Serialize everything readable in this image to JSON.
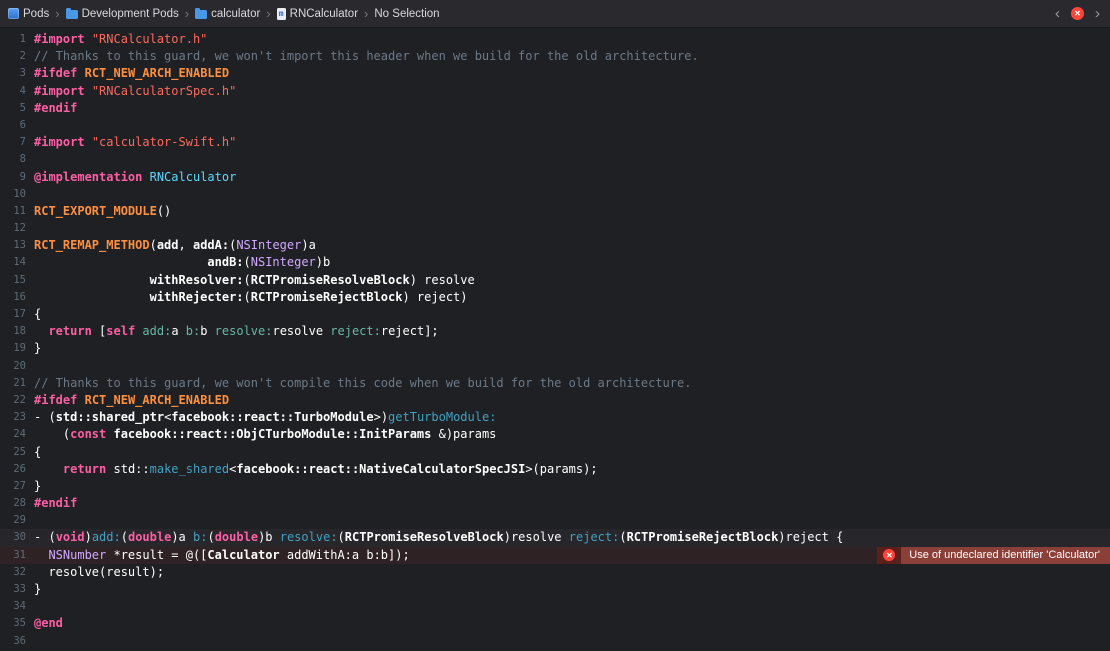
{
  "breadcrumb": {
    "items": [
      {
        "label": "Pods",
        "icon": "project"
      },
      {
        "label": "Development Pods",
        "icon": "folder"
      },
      {
        "label": "calculator",
        "icon": "folder"
      },
      {
        "label": "RNCalculator",
        "icon": "file-m"
      },
      {
        "label": "No Selection",
        "icon": "none"
      }
    ],
    "separator": "›",
    "nav": {
      "back": "‹",
      "forward": "›"
    },
    "issues": {
      "error_glyph": "✕",
      "file_icon_glyph": "m"
    }
  },
  "colors": {
    "background": "#1f2024",
    "topbar": "#29292e",
    "keyword": "#fc5fa3",
    "macro": "#fd8f3f",
    "string": "#fc6a5d",
    "comment": "#6c7986",
    "other_type": "#d0a8ff",
    "type_declaration": "#5dd8ff",
    "project_method": "#67b7a4",
    "other_declaration": "#41a1c0",
    "plain_text": "#ffffff",
    "line_number": "#5f6b76",
    "error_badge": "#ff453a",
    "error_banner": "#8a3f38"
  },
  "editor": {
    "error": {
      "line": 31,
      "message": "Use of undeclared identifier 'Calculator'",
      "icon_glyph": "✕"
    },
    "current_line": 30,
    "lines": [
      {
        "n": 1,
        "tokens": [
          {
            "c": "kw",
            "t": "#import"
          },
          {
            "c": "pln",
            "t": " "
          },
          {
            "c": "str",
            "t": "\"RNCalculator.h\""
          }
        ]
      },
      {
        "n": 2,
        "tokens": [
          {
            "c": "com",
            "t": "// Thanks to this guard, we won't import this header when we build for the old architecture."
          }
        ]
      },
      {
        "n": 3,
        "tokens": [
          {
            "c": "kw",
            "t": "#ifdef"
          },
          {
            "c": "pln",
            "t": " "
          },
          {
            "c": "mac",
            "t": "RCT_NEW_ARCH_ENABLED"
          }
        ]
      },
      {
        "n": 4,
        "tokens": [
          {
            "c": "kw",
            "t": "#import"
          },
          {
            "c": "pln",
            "t": " "
          },
          {
            "c": "str",
            "t": "\"RNCalculatorSpec.h\""
          }
        ]
      },
      {
        "n": 5,
        "tokens": [
          {
            "c": "kw",
            "t": "#endif"
          }
        ]
      },
      {
        "n": 6,
        "tokens": []
      },
      {
        "n": 7,
        "tokens": [
          {
            "c": "kw",
            "t": "#import"
          },
          {
            "c": "pln",
            "t": " "
          },
          {
            "c": "str",
            "t": "\"calculator-Swift.h\""
          }
        ]
      },
      {
        "n": 8,
        "tokens": []
      },
      {
        "n": 9,
        "tokens": [
          {
            "c": "kw",
            "t": "@implementation"
          },
          {
            "c": "pln",
            "t": " "
          },
          {
            "c": "cls",
            "t": "RNCalculator"
          }
        ]
      },
      {
        "n": 10,
        "tokens": []
      },
      {
        "n": 11,
        "tokens": [
          {
            "c": "mac",
            "t": "RCT_EXPORT_MODULE"
          },
          {
            "c": "pln",
            "t": "()"
          }
        ]
      },
      {
        "n": 12,
        "tokens": []
      },
      {
        "n": 13,
        "tokens": [
          {
            "c": "mac",
            "t": "RCT_REMAP_METHOD"
          },
          {
            "c": "pln",
            "t": "("
          },
          {
            "c": "plnb",
            "t": "add"
          },
          {
            "c": "pln",
            "t": ", "
          },
          {
            "c": "plnb",
            "t": "addA:"
          },
          {
            "c": "pln",
            "t": "("
          },
          {
            "c": "typ",
            "t": "NSInteger"
          },
          {
            "c": "pln",
            "t": ")a"
          }
        ]
      },
      {
        "n": 14,
        "tokens": [
          {
            "c": "pln",
            "t": "                        "
          },
          {
            "c": "plnb",
            "t": "andB:"
          },
          {
            "c": "pln",
            "t": "("
          },
          {
            "c": "typ",
            "t": "NSInteger"
          },
          {
            "c": "pln",
            "t": ")b"
          }
        ]
      },
      {
        "n": 15,
        "tokens": [
          {
            "c": "pln",
            "t": "                "
          },
          {
            "c": "plnb",
            "t": "withResolver:"
          },
          {
            "c": "pln",
            "t": "("
          },
          {
            "c": "plnb",
            "t": "RCTPromiseResolveBlock"
          },
          {
            "c": "pln",
            "t": ") resolve"
          }
        ]
      },
      {
        "n": 16,
        "tokens": [
          {
            "c": "pln",
            "t": "                "
          },
          {
            "c": "plnb",
            "t": "withRejecter:"
          },
          {
            "c": "pln",
            "t": "("
          },
          {
            "c": "plnb",
            "t": "RCTPromiseRejectBlock"
          },
          {
            "c": "pln",
            "t": ") reject)"
          }
        ]
      },
      {
        "n": 17,
        "tokens": [
          {
            "c": "pln",
            "t": "{"
          }
        ]
      },
      {
        "n": 18,
        "tokens": [
          {
            "c": "pln",
            "t": "  "
          },
          {
            "c": "kw",
            "t": "return"
          },
          {
            "c": "pln",
            "t": " ["
          },
          {
            "c": "kw",
            "t": "self"
          },
          {
            "c": "pln",
            "t": " "
          },
          {
            "c": "meth",
            "t": "add:"
          },
          {
            "c": "pln",
            "t": "a "
          },
          {
            "c": "meth",
            "t": "b:"
          },
          {
            "c": "pln",
            "t": "b "
          },
          {
            "c": "meth",
            "t": "resolve:"
          },
          {
            "c": "pln",
            "t": "resolve "
          },
          {
            "c": "meth",
            "t": "reject:"
          },
          {
            "c": "pln",
            "t": "reject];"
          }
        ]
      },
      {
        "n": 19,
        "tokens": [
          {
            "c": "pln",
            "t": "}"
          }
        ]
      },
      {
        "n": 20,
        "tokens": []
      },
      {
        "n": 21,
        "tokens": [
          {
            "c": "com",
            "t": "// Thanks to this guard, we won't compile this code when we build for the old architecture."
          }
        ]
      },
      {
        "n": 22,
        "tokens": [
          {
            "c": "kw",
            "t": "#ifdef"
          },
          {
            "c": "pln",
            "t": " "
          },
          {
            "c": "mac",
            "t": "RCT_NEW_ARCH_ENABLED"
          }
        ]
      },
      {
        "n": 23,
        "tokens": [
          {
            "c": "pln",
            "t": "- ("
          },
          {
            "c": "plnb",
            "t": "std::shared_ptr"
          },
          {
            "c": "pln",
            "t": "<"
          },
          {
            "c": "plnb",
            "t": "facebook::react::TurboModule"
          },
          {
            "c": "pln",
            "t": ">)"
          },
          {
            "c": "decl",
            "t": "getTurboModule:"
          }
        ]
      },
      {
        "n": 24,
        "tokens": [
          {
            "c": "pln",
            "t": "    ("
          },
          {
            "c": "kw",
            "t": "const"
          },
          {
            "c": "pln",
            "t": " "
          },
          {
            "c": "plnb",
            "t": "facebook::react::ObjCTurboModule::InitParams"
          },
          {
            "c": "pln",
            "t": " &)params"
          }
        ]
      },
      {
        "n": 25,
        "tokens": [
          {
            "c": "pln",
            "t": "{"
          }
        ]
      },
      {
        "n": 26,
        "tokens": [
          {
            "c": "pln",
            "t": "    "
          },
          {
            "c": "kw",
            "t": "return"
          },
          {
            "c": "pln",
            "t": " std::"
          },
          {
            "c": "decl",
            "t": "make_shared"
          },
          {
            "c": "pln",
            "t": "<"
          },
          {
            "c": "plnb",
            "t": "facebook::react::NativeCalculatorSpecJSI"
          },
          {
            "c": "pln",
            "t": ">(params);"
          }
        ]
      },
      {
        "n": 27,
        "tokens": [
          {
            "c": "pln",
            "t": "}"
          }
        ]
      },
      {
        "n": 28,
        "tokens": [
          {
            "c": "kw",
            "t": "#endif"
          }
        ]
      },
      {
        "n": 29,
        "tokens": []
      },
      {
        "n": 30,
        "tokens": [
          {
            "c": "pln",
            "t": "- ("
          },
          {
            "c": "kw",
            "t": "void"
          },
          {
            "c": "pln",
            "t": ")"
          },
          {
            "c": "decl",
            "t": "add:"
          },
          {
            "c": "pln",
            "t": "("
          },
          {
            "c": "kw",
            "t": "double"
          },
          {
            "c": "pln",
            "t": ")a "
          },
          {
            "c": "decl",
            "t": "b:"
          },
          {
            "c": "pln",
            "t": "("
          },
          {
            "c": "kw",
            "t": "double"
          },
          {
            "c": "pln",
            "t": ")b "
          },
          {
            "c": "decl",
            "t": "resolve:"
          },
          {
            "c": "pln",
            "t": "("
          },
          {
            "c": "plnb",
            "t": "RCTPromiseResolveBlock"
          },
          {
            "c": "pln",
            "t": ")resolve "
          },
          {
            "c": "decl",
            "t": "reject:"
          },
          {
            "c": "pln",
            "t": "("
          },
          {
            "c": "plnb",
            "t": "RCTPromiseRejectBlock"
          },
          {
            "c": "pln",
            "t": ")reject {"
          }
        ]
      },
      {
        "n": 31,
        "tokens": [
          {
            "c": "pln",
            "t": "  "
          },
          {
            "c": "typ",
            "t": "NSNumber"
          },
          {
            "c": "pln",
            "t": " *result = @(["
          },
          {
            "c": "plnb",
            "t": "Calculator"
          },
          {
            "c": "pln",
            "t": " addWithA:a b:b]);"
          }
        ]
      },
      {
        "n": 32,
        "tokens": [
          {
            "c": "pln",
            "t": "  resolve(result);"
          }
        ]
      },
      {
        "n": 33,
        "tokens": [
          {
            "c": "pln",
            "t": "}"
          }
        ]
      },
      {
        "n": 34,
        "tokens": []
      },
      {
        "n": 35,
        "tokens": [
          {
            "c": "kw",
            "t": "@end"
          }
        ]
      },
      {
        "n": 36,
        "tokens": []
      }
    ]
  }
}
